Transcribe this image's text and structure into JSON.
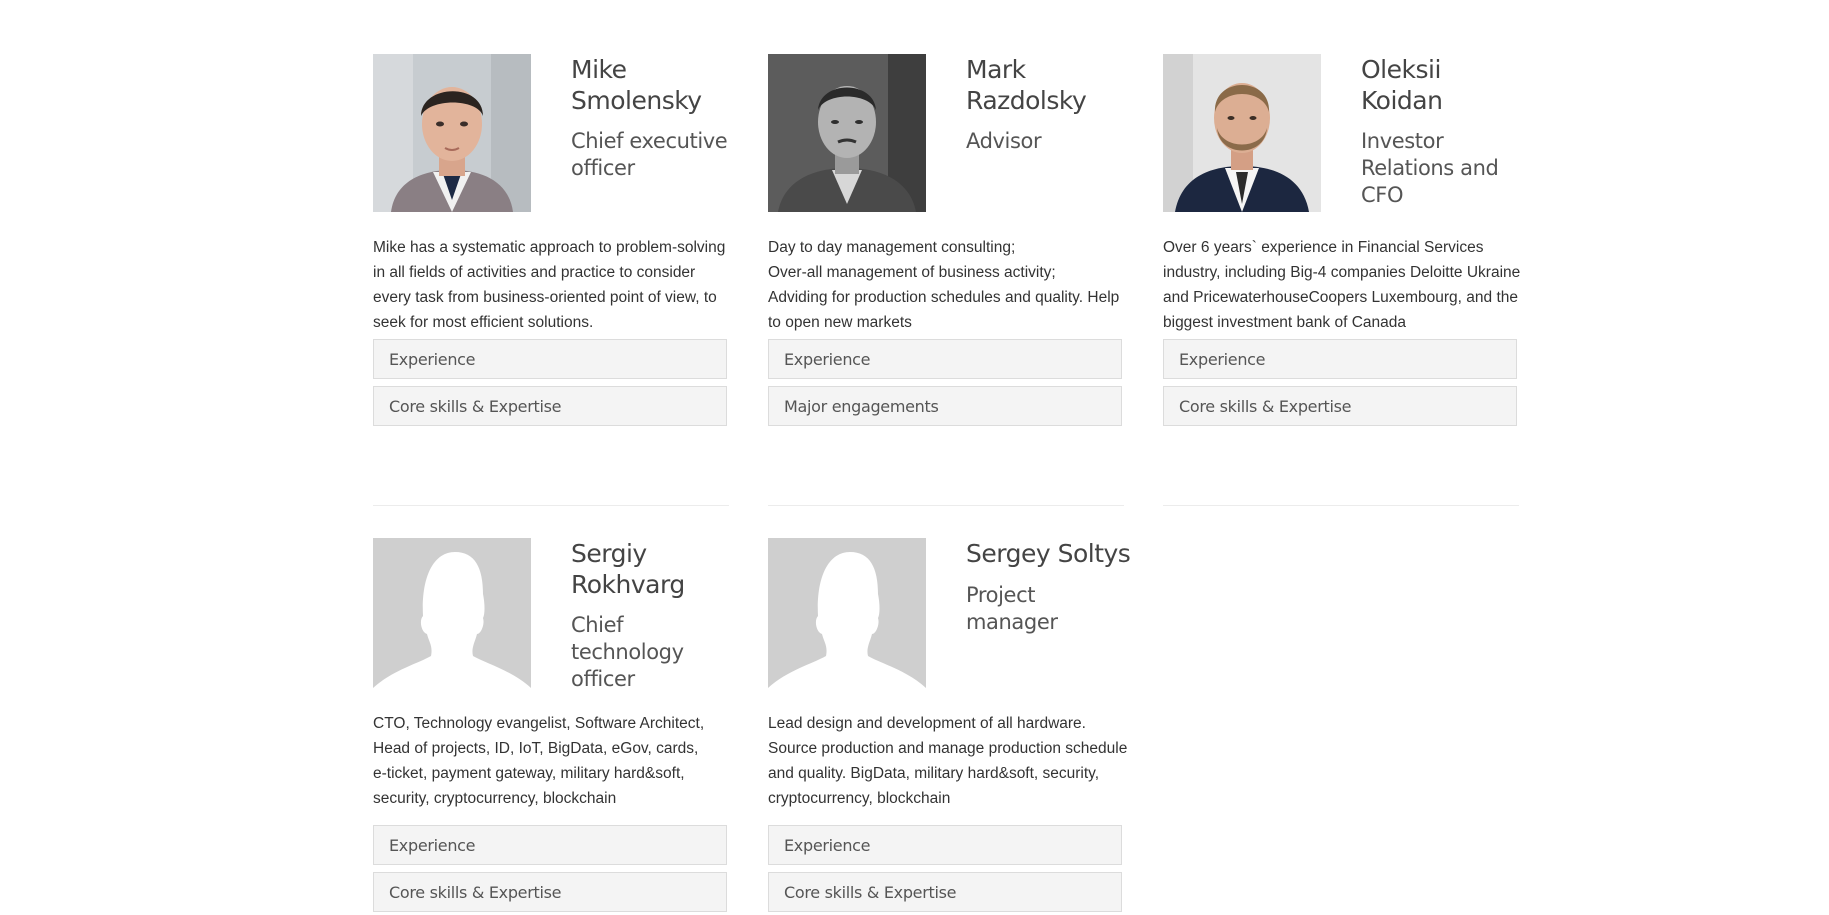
{
  "members": [
    {
      "name": "Mike Smolensky",
      "name_lines": [
        "Mike",
        "Smolensky"
      ],
      "role_lines": [
        "Chief executive",
        "officer"
      ],
      "bio_lines": [
        "Mike has a systematic approach to problem-solving",
        "in all fields of activities and practice to consider",
        "every task from business-oriented point of view, to",
        "seek for most efficient solutions."
      ],
      "accordion": [
        "Experience",
        "Core skills & Expertise"
      ],
      "photo": "portrait-photo"
    },
    {
      "name": "Mark Razdolsky",
      "name_lines": [
        "Mark",
        "Razdolsky"
      ],
      "role_lines": [
        "Advisor"
      ],
      "bio_lines": [
        "Day to day management consulting;",
        "Over-all management of business activity;",
        "Adviding for production schedules and quality. Help",
        "to open new markets"
      ],
      "accordion": [
        "Experience",
        "Major engagements"
      ],
      "photo": "portrait-photo-bw"
    },
    {
      "name": "Oleksii Koidan",
      "name_lines": [
        "Oleksii",
        "Koidan"
      ],
      "role_lines": [
        "Investor",
        "Relations and",
        "CFO"
      ],
      "bio_lines": [
        "Over 6 years` experience in Financial Services",
        "industry, including Big-4 companies Deloitte Ukraine",
        "and PricewaterhouseCoopers Luxembourg, and the",
        "biggest investment bank of Canada"
      ],
      "accordion": [
        "Experience",
        "Core skills & Expertise"
      ],
      "photo": "portrait-photo"
    },
    {
      "name": "Sergiy Rokhvarg",
      "name_lines": [
        "Sergiy",
        "Rokhvarg"
      ],
      "role_lines": [
        "Chief",
        "technology",
        "officer"
      ],
      "bio_lines": [
        "CTO, Technology evangelist, Software Architect,",
        "Head of projects, ID, IoT, BigData, eGov, cards,",
        "e-ticket, payment gateway, military hard&soft,",
        "security, cryptocurrency, blockchain"
      ],
      "accordion": [
        "Experience",
        "Core skills & Expertise"
      ],
      "photo": "placeholder-silhouette"
    },
    {
      "name": "Sergey Soltys",
      "name_lines": [
        "Sergey Soltys"
      ],
      "role_lines": [
        "Project",
        "manager"
      ],
      "bio_lines": [
        "Lead design and development of all hardware.",
        "Source production and manage production schedule",
        "and quality. BigData, military hard&soft, security,",
        "cryptocurrency, blockchain"
      ],
      "accordion": [
        "Experience",
        "Core skills & Expertise"
      ],
      "photo": "placeholder-silhouette"
    }
  ],
  "colors": {
    "text": "#333333",
    "heading": "#444444",
    "accordion_bg": "#f4f4f4",
    "accordion_border": "#dcdcdc",
    "placeholder_bg": "#cfcfcf",
    "divider": "#ececec"
  }
}
